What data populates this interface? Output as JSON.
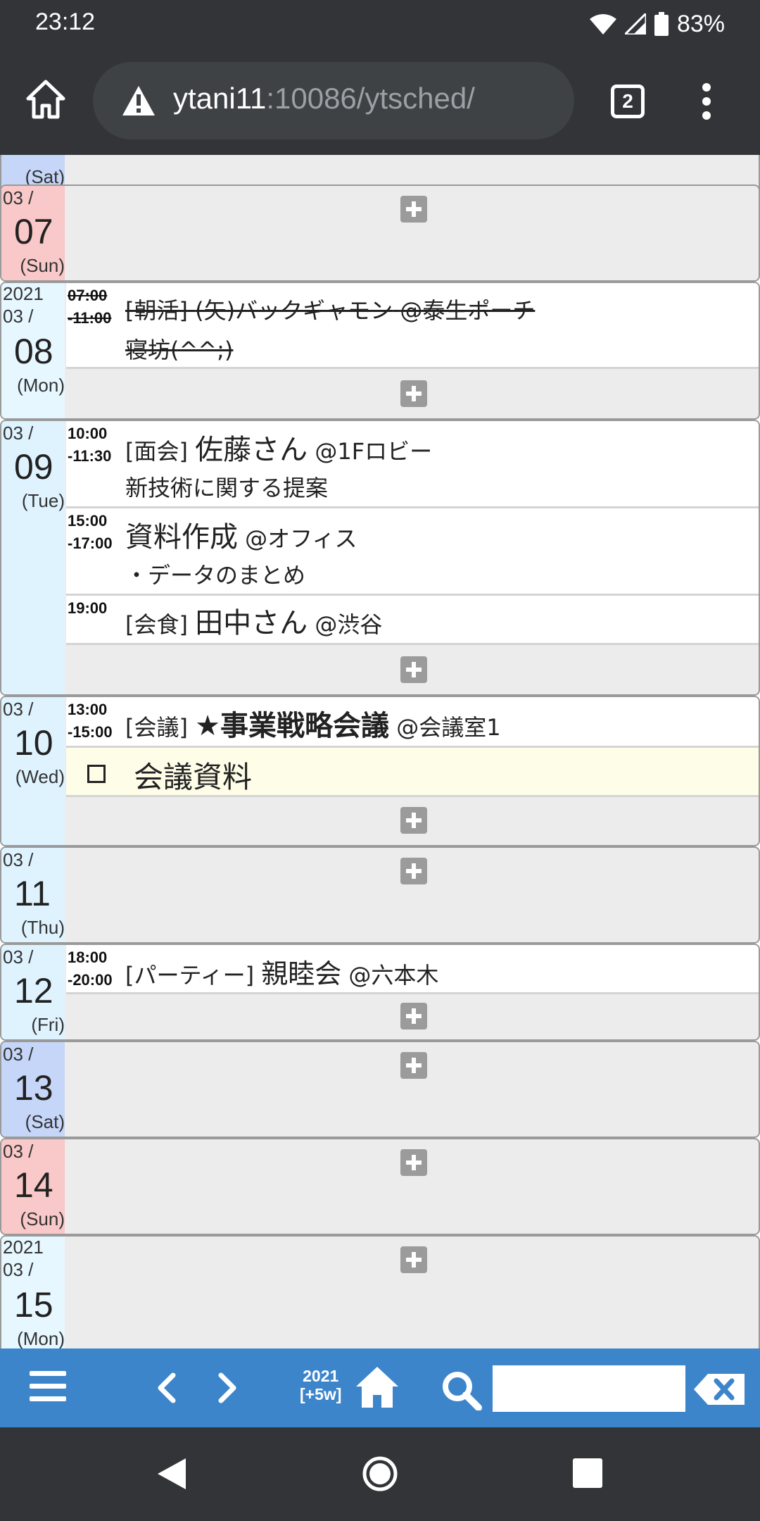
{
  "status": {
    "time": "23:12",
    "battery": "83%"
  },
  "browser": {
    "url_host": "ytani11",
    "url_rest": ":10086/ytsched/",
    "tab_count": "2"
  },
  "days": [
    {
      "month": "",
      "day": "",
      "weekday": "(Sat)",
      "year": ""
    },
    {
      "month": "03 /",
      "day": "07",
      "weekday": "(Sun)",
      "year": ""
    },
    {
      "month": "03 /",
      "day": "08",
      "weekday": "(Mon)",
      "year": "2021"
    },
    {
      "month": "03 /",
      "day": "09",
      "weekday": "(Tue)",
      "year": ""
    },
    {
      "month": "03 /",
      "day": "10",
      "weekday": "(Wed)",
      "year": ""
    },
    {
      "month": "03 /",
      "day": "11",
      "weekday": "(Thu)",
      "year": ""
    },
    {
      "month": "03 /",
      "day": "12",
      "weekday": "(Fri)",
      "year": ""
    },
    {
      "month": "03 /",
      "day": "13",
      "weekday": "(Sat)",
      "year": ""
    },
    {
      "month": "03 /",
      "day": "14",
      "weekday": "(Sun)",
      "year": ""
    },
    {
      "month": "03 /",
      "day": "15",
      "weekday": "(Mon)",
      "year": "2021"
    }
  ],
  "events": {
    "mar08": {
      "start": "07:00",
      "end": "-11:00",
      "category": "[朝活]",
      "title": "(矢)バックギャモン",
      "place": "@泰生ポーチ",
      "note": "寝坊(^^;)"
    },
    "mar09a": {
      "start": "10:00",
      "end": "-11:30",
      "category": "[面会]",
      "title": "佐藤さん",
      "place": "@1Fロビー",
      "note": "新技術に関する提案"
    },
    "mar09b": {
      "start": "15:00",
      "end": "-17:00",
      "category": "",
      "title": "資料作成",
      "place": "@オフィス",
      "note": "・データのまとめ"
    },
    "mar09c": {
      "start": "19:00",
      "end": "",
      "category": "[会食]",
      "title": "田中さん",
      "place": "@渋谷",
      "note": ""
    },
    "mar10": {
      "start": "13:00",
      "end": "-15:00",
      "category": "[会議]",
      "title": "★事業戦略会議",
      "place": "@会議室1",
      "note": ""
    },
    "mar12": {
      "start": "18:00",
      "end": "-20:00",
      "category": "[パーティー]",
      "title": "親睦会",
      "place": "@六本木",
      "note": ""
    }
  },
  "todos": {
    "mar10": "会議資料"
  },
  "appbar": {
    "year": "2021",
    "range": "[+5w]",
    "search_value": ""
  },
  "colors": {
    "sat": "#c6d6f8",
    "sun": "#f9c8c8",
    "weekday": "#dff3ff",
    "weekday_alt": "#e6f7ff",
    "appbar": "#3d85cb"
  }
}
